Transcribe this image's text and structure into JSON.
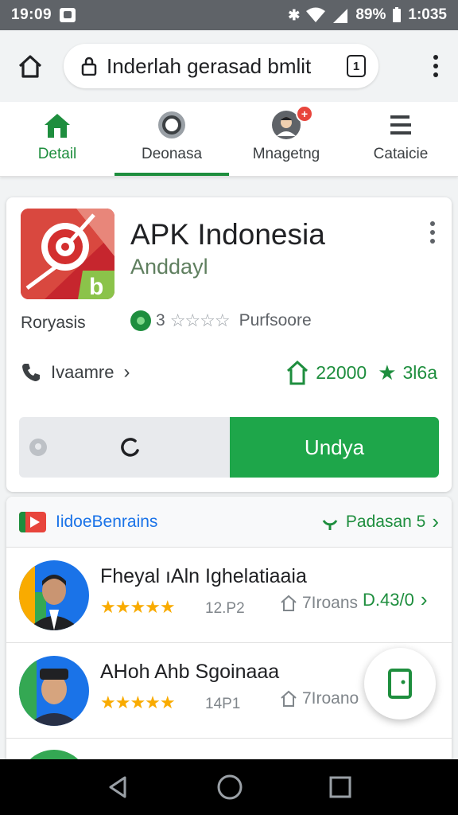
{
  "status_bar": {
    "time": "19:09",
    "battery": "89%",
    "clock_right": "1:035",
    "icons": [
      "notification-icon",
      "bluetooth-icon",
      "wifi-icon",
      "signal-icon"
    ]
  },
  "browser": {
    "url": "Inderlah gerasad bmlit",
    "tab_count": "1"
  },
  "tabs": [
    {
      "label": "Detail",
      "icon": "home-icon",
      "active": true
    },
    {
      "label": "Deonasa",
      "icon": "circle-icon",
      "underline": true
    },
    {
      "label": "Mnagetng",
      "icon": "avatar-icon",
      "badge": "+"
    },
    {
      "label": "Cataicie",
      "icon": "menu-lines-icon"
    }
  ],
  "app": {
    "title": "APK Indonesia",
    "developer": "Anddayl",
    "category": "Roryasis",
    "rating_text": "3",
    "rating_label": "Purfsoore",
    "contact_label": "Ivaamre",
    "downloads": "22000",
    "score": "3l6a",
    "install_label": "Undya"
  },
  "list": {
    "title": "IidoeBenrains",
    "action_label": "Padasan 5",
    "items": [
      {
        "name": "Fheyal ıAln Ighelatiaaia",
        "stars": "★★★★★",
        "reviews": "12.P2",
        "meta": "7Iroans",
        "price": "D.43/0"
      },
      {
        "name": "AHoh Ahb Sgoinaaa",
        "stars": "★★★★★",
        "reviews": "14P1",
        "meta": "7Iroano",
        "price": ""
      }
    ]
  },
  "colors": {
    "accent_green": "#1e8e3e",
    "install_green": "#1ea64a",
    "link_blue": "#1a73e8",
    "star_yellow": "#f9ab00",
    "badge_red": "#e8453c"
  }
}
